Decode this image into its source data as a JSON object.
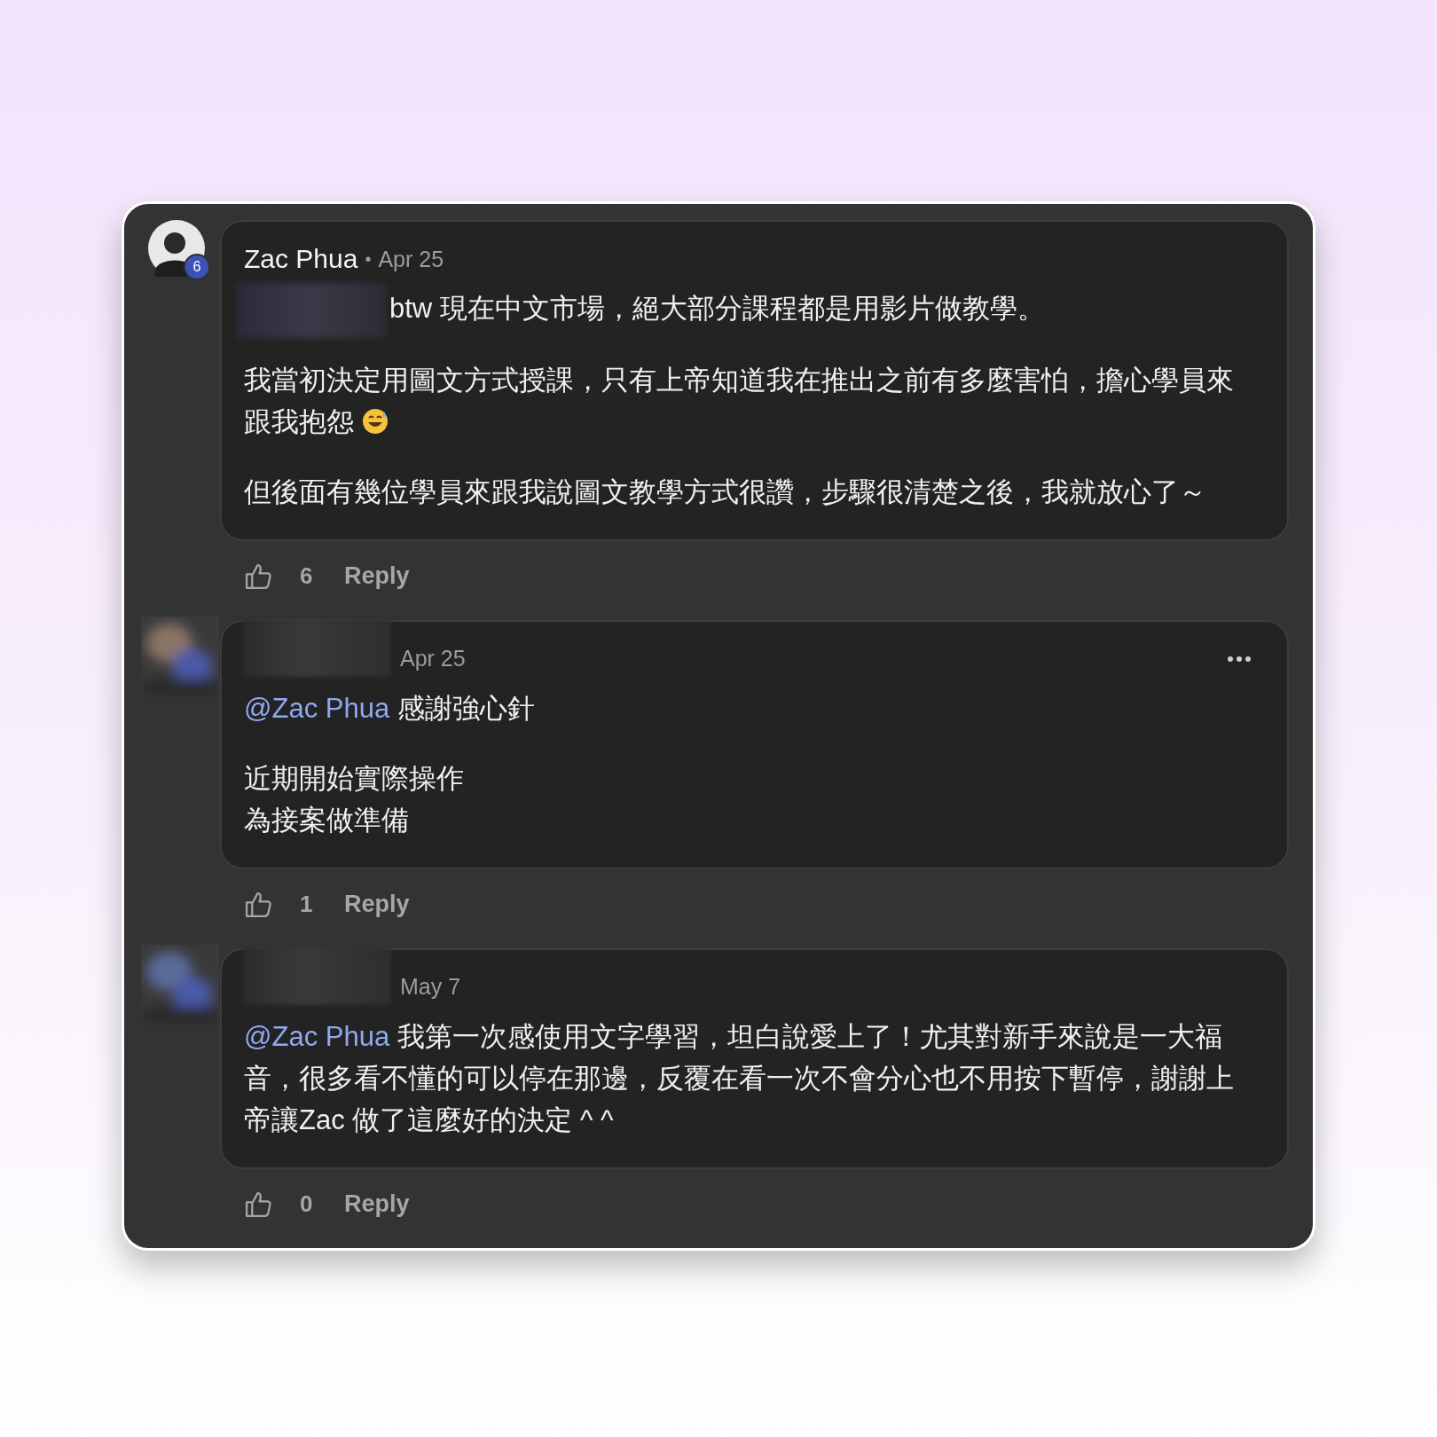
{
  "comments": [
    {
      "author": "Zac Phua",
      "author_hidden": false,
      "separator": "•",
      "date": "Apr 25",
      "menu": false,
      "avatar": {
        "blurred": false,
        "badge": "6"
      },
      "paragraphs": [
        {
          "redacted_mention": true,
          "lines": [
            "btw 現在中文市場，絕大部分課程都是用影片做教學。"
          ]
        },
        {
          "lines": [
            "我當初決定用圖文方式授課，只有上帝知道我在推出之前有多麼害怕，擔心學員來",
            "跟我抱怨"
          ],
          "emoji": true
        },
        {
          "lines": [
            "但後面有幾位學員來跟我說圖文教學方式很讚，步驟很清楚之後，我就放心了～"
          ]
        }
      ],
      "likes": "6",
      "reply": "Reply"
    },
    {
      "author_hidden": true,
      "date": "Apr 25",
      "menu": true,
      "avatar": {
        "blurred": true
      },
      "paragraphs": [
        {
          "mention": "@Zac Phua",
          "lines": [
            "感謝強心針"
          ]
        },
        {
          "lines": [
            "近期開始實際操作",
            "為接案做準備"
          ]
        }
      ],
      "likes": "1",
      "reply": "Reply"
    },
    {
      "author_hidden": true,
      "date": "May 7",
      "menu": false,
      "avatar": {
        "blurred": true
      },
      "paragraphs": [
        {
          "mention": "@Zac Phua",
          "lines": [
            "我第一次感使用文字學習，坦白說愛上了！尤其對新手來說是一大福",
            "音，很多看不懂的可以停在那邊，反覆在看一次不會分心也不用按下暫停，謝謝上",
            "帝讓Zac 做了這麼好的決定 ^ ^"
          ]
        }
      ],
      "likes": "0",
      "reply": "Reply"
    }
  ]
}
